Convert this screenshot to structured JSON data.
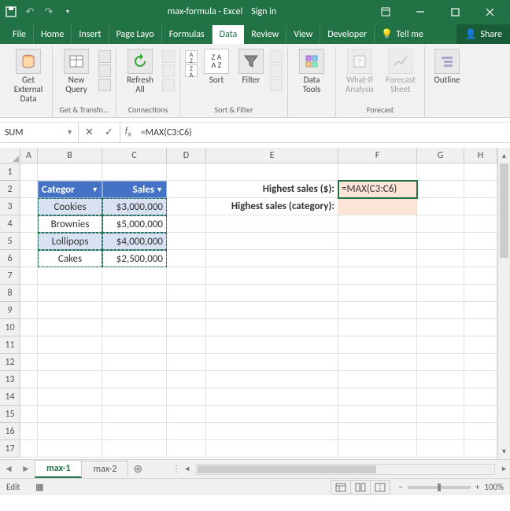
{
  "titlebar": {
    "doc": "max-formula - Excel",
    "signin": "Sign in"
  },
  "menu": {
    "tabs": [
      "File",
      "Home",
      "Insert",
      "Page Layo",
      "Formulas",
      "Data",
      "Review",
      "View",
      "Developer"
    ],
    "active": "Data",
    "tellme": "Tell me",
    "share": "Share"
  },
  "ribbon": {
    "g1": {
      "label": "",
      "b1": "Get External\nData"
    },
    "g2": {
      "label": "Get & Transfo...",
      "b1": "New\nQuery"
    },
    "g3": {
      "label": "Connections",
      "b1": "Refresh\nAll"
    },
    "g4": {
      "label": "Sort & Filter",
      "b1": "Sort",
      "b2": "Filter"
    },
    "g5": {
      "label": "",
      "b1": "Data\nTools"
    },
    "g6": {
      "label": "Forecast",
      "b1": "What-If\nAnalysis",
      "b2": "Forecast\nSheet"
    },
    "g7": {
      "label": "",
      "b1": "Outline"
    }
  },
  "formulabar": {
    "namebox": "SUM",
    "formula": "=MAX(C3:C6)"
  },
  "columns": [
    "A",
    "B",
    "C",
    "D",
    "E",
    "F",
    "G",
    "H"
  ],
  "rows": [
    "1",
    "2",
    "3",
    "4",
    "5",
    "6",
    "7",
    "8",
    "9",
    "10",
    "11",
    "12",
    "13",
    "14",
    "15",
    "16",
    "17"
  ],
  "table": {
    "headers": {
      "cat": "Categor",
      "sales": "Sales"
    },
    "data": [
      {
        "cat": "Cookies",
        "sales": "$3,000,000"
      },
      {
        "cat": "Brownies",
        "sales": "$5,000,000"
      },
      {
        "cat": "Lollipops",
        "sales": "$4,000,000"
      },
      {
        "cat": "Cakes",
        "sales": "$2,500,000"
      }
    ]
  },
  "labels": {
    "e2": "Highest sales ($):",
    "e3": "Highest sales (category):",
    "f2": "=MAX(C3:C6)"
  },
  "sheets": {
    "active": "max-1",
    "other": "max-2"
  },
  "status": {
    "mode": "Edit",
    "zoom": "100%"
  }
}
